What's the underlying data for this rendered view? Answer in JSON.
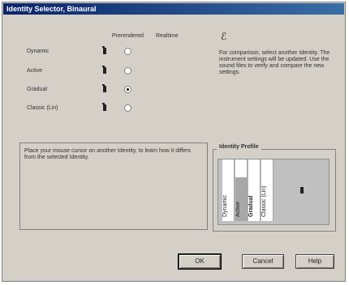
{
  "window": {
    "title": "Identity Selector, Binaural"
  },
  "columns": {
    "prerendered": "Prerendered",
    "realtime": "Realtime"
  },
  "identities": [
    {
      "label": "Dynamic",
      "checked": false
    },
    {
      "label": "Active",
      "checked": false
    },
    {
      "label": "Gradual",
      "checked": true
    },
    {
      "label": "Classic (Lin)",
      "checked": false
    }
  ],
  "comparison_text": "For comparison, select another Identity. The instrument settings will be updated. Use the sound files to verify and compare the new settings.",
  "hint_text": "Place your mouse cursor on another Identity, to learn how it differs from the selected Identity.",
  "profile": {
    "title": "Identity Profile",
    "bars": [
      "Dynamic",
      "Active",
      "Gradual",
      "Classic (Lin)"
    ],
    "selected": "Gradual"
  },
  "buttons": {
    "ok": "OK",
    "cancel": "Cancel",
    "help": "Help"
  }
}
